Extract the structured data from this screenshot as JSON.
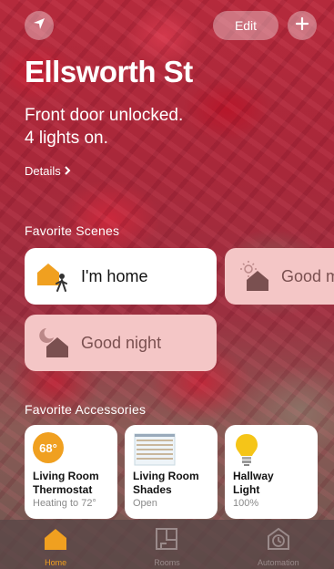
{
  "header": {
    "edit_label": "Edit",
    "title": "Ellsworth St",
    "status_line1": "Front door unlocked.",
    "status_line2": "4 lights on.",
    "details_label": "Details"
  },
  "scenes": {
    "section_title": "Favorite Scenes",
    "items": [
      {
        "label": "I'm home",
        "active": true,
        "icon": "arriving-home-icon"
      },
      {
        "label": "Good m",
        "active": false,
        "icon": "sunrise-home-icon"
      },
      {
        "label": "Good night",
        "active": false,
        "icon": "moon-home-icon"
      }
    ]
  },
  "accessories": {
    "section_title": "Favorite Accessories",
    "items": [
      {
        "name_line1": "Living Room",
        "name_line2": "Thermostat",
        "state": "Heating to 72°",
        "badge": "68°",
        "icon": "thermostat-icon"
      },
      {
        "name_line1": "Living Room",
        "name_line2": "Shades",
        "state": "Open",
        "icon": "window-shades-icon"
      },
      {
        "name_line1": "Hallway",
        "name_line2": "Light",
        "state": "100%",
        "icon": "light-bulb-icon"
      }
    ]
  },
  "tabbar": {
    "items": [
      {
        "label": "Home",
        "active": true,
        "icon": "home-tab-icon"
      },
      {
        "label": "Rooms",
        "active": false,
        "icon": "rooms-tab-icon"
      },
      {
        "label": "Automation",
        "active": false,
        "icon": "automation-tab-icon"
      }
    ]
  },
  "colors": {
    "accent": "#f0a020",
    "active_scene_bg": "#ffffff",
    "inactive_scene_bg": "#f4c6c6",
    "inactive_text": "#7a5050"
  }
}
